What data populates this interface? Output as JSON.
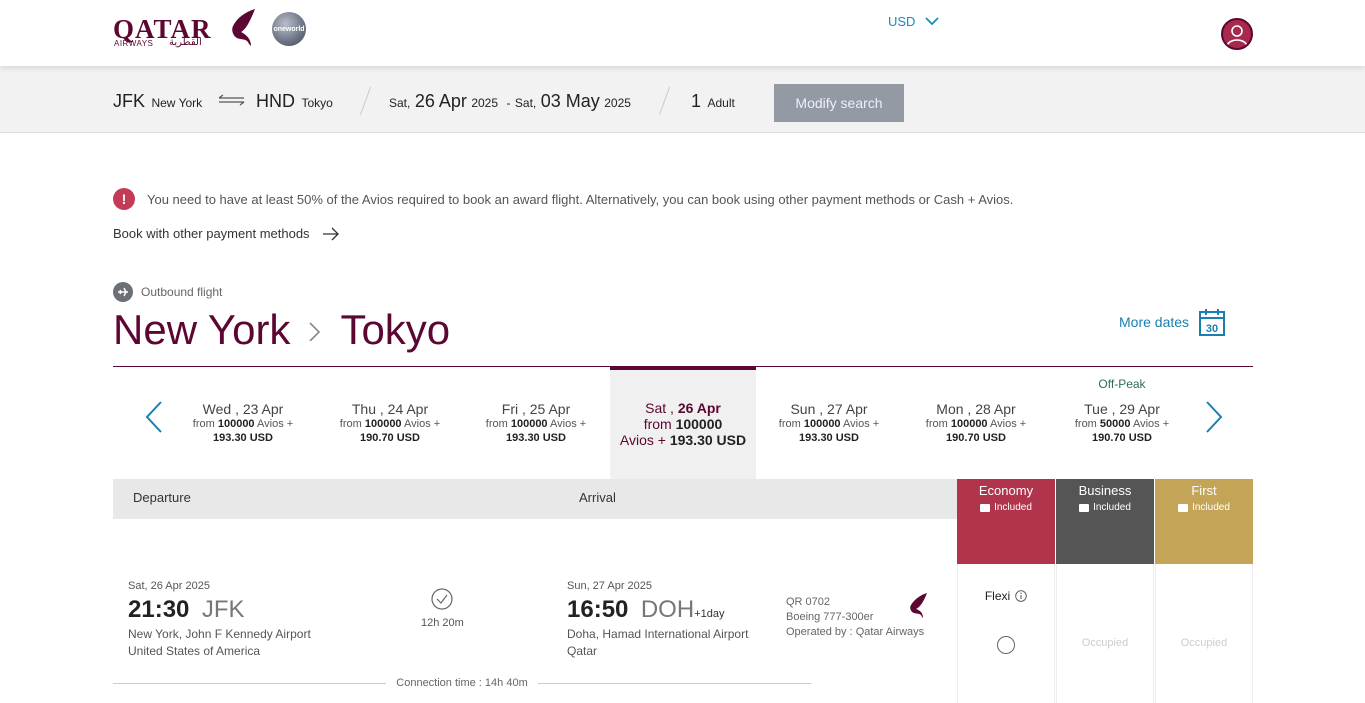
{
  "header": {
    "logo_text": "QATAR",
    "logo_sub": "AIRWAYS",
    "logo_arabic": "القطرية",
    "alliance": "oneworld",
    "currency": "USD"
  },
  "search": {
    "origin_code": "JFK",
    "origin_city": "New York",
    "dest_code": "HND",
    "dest_city": "Tokyo",
    "depart_dow": "Sat,",
    "depart_day": "26 Apr",
    "depart_year": "2025",
    "return_sep": "-",
    "return_dow": "Sat,",
    "return_day": "03 May",
    "return_year": "2025",
    "pax_count": "1",
    "pax_label": "Adult",
    "modify_label": "Modify search"
  },
  "notice": {
    "icon": "!",
    "text": "You need to have at least 50% of the Avios required to book an award flight. Alternatively, you can book using other payment methods or Cash + Avios.",
    "book_other": "Book with other payment methods"
  },
  "outbound": {
    "label": "Outbound flight",
    "from": "New York",
    "to": "Tokyo",
    "more_dates": "More dates",
    "calendar_day": "30"
  },
  "dates": [
    {
      "day": "Wed , 23 Apr",
      "avios": "100000",
      "cash": "193.30 USD",
      "offpeak": ""
    },
    {
      "day": "Thu , 24 Apr",
      "avios": "100000",
      "cash": "190.70 USD",
      "offpeak": ""
    },
    {
      "day": "Fri , 25 Apr",
      "avios": "100000",
      "cash": "193.30 USD",
      "offpeak": ""
    },
    {
      "day_prefix": "Sat ,",
      "day_bold": "26 Apr",
      "avios": "100000",
      "cash": "193.30 USD",
      "offpeak": ""
    },
    {
      "day": "Sun , 27 Apr",
      "avios": "100000",
      "cash": "193.30 USD",
      "offpeak": ""
    },
    {
      "day": "Mon , 28 Apr",
      "avios": "100000",
      "cash": "190.70 USD",
      "offpeak": ""
    },
    {
      "day": "Tue , 29 Apr",
      "avios": "50000",
      "cash": "190.70 USD",
      "offpeak": "Off-Peak"
    }
  ],
  "price_words": {
    "from": "from",
    "avios_plus": "Avios +"
  },
  "table": {
    "departure": "Departure",
    "arrival": "Arrival",
    "cabins": [
      {
        "name": "Economy",
        "included": "Included",
        "color": "#b0344c"
      },
      {
        "name": "Business",
        "included": "Included",
        "color": "#555555"
      },
      {
        "name": "First",
        "included": "Included",
        "color": "#c4a457"
      }
    ]
  },
  "flight": {
    "dep_date": "Sat, 26 Apr 2025",
    "dep_time": "21:30",
    "dep_code": "JFK",
    "dep_airport": "New York, John F Kennedy Airport",
    "dep_country": "United States of America",
    "duration": "12h 20m",
    "arr_date": "Sun, 27 Apr 2025",
    "arr_time": "16:50",
    "arr_code": "DOH",
    "arr_plus": "+1day",
    "arr_airport": "Doha, Hamad International Airport",
    "arr_country": "Qatar",
    "flight_no": "QR 0702",
    "aircraft": "Boeing 777-300er",
    "operated": "Operated by : Qatar Airways",
    "fare_economy": "Flexi",
    "fare_business": "Occupied",
    "fare_first": "Occupied",
    "connection": "Connection time : 14h 40m"
  }
}
